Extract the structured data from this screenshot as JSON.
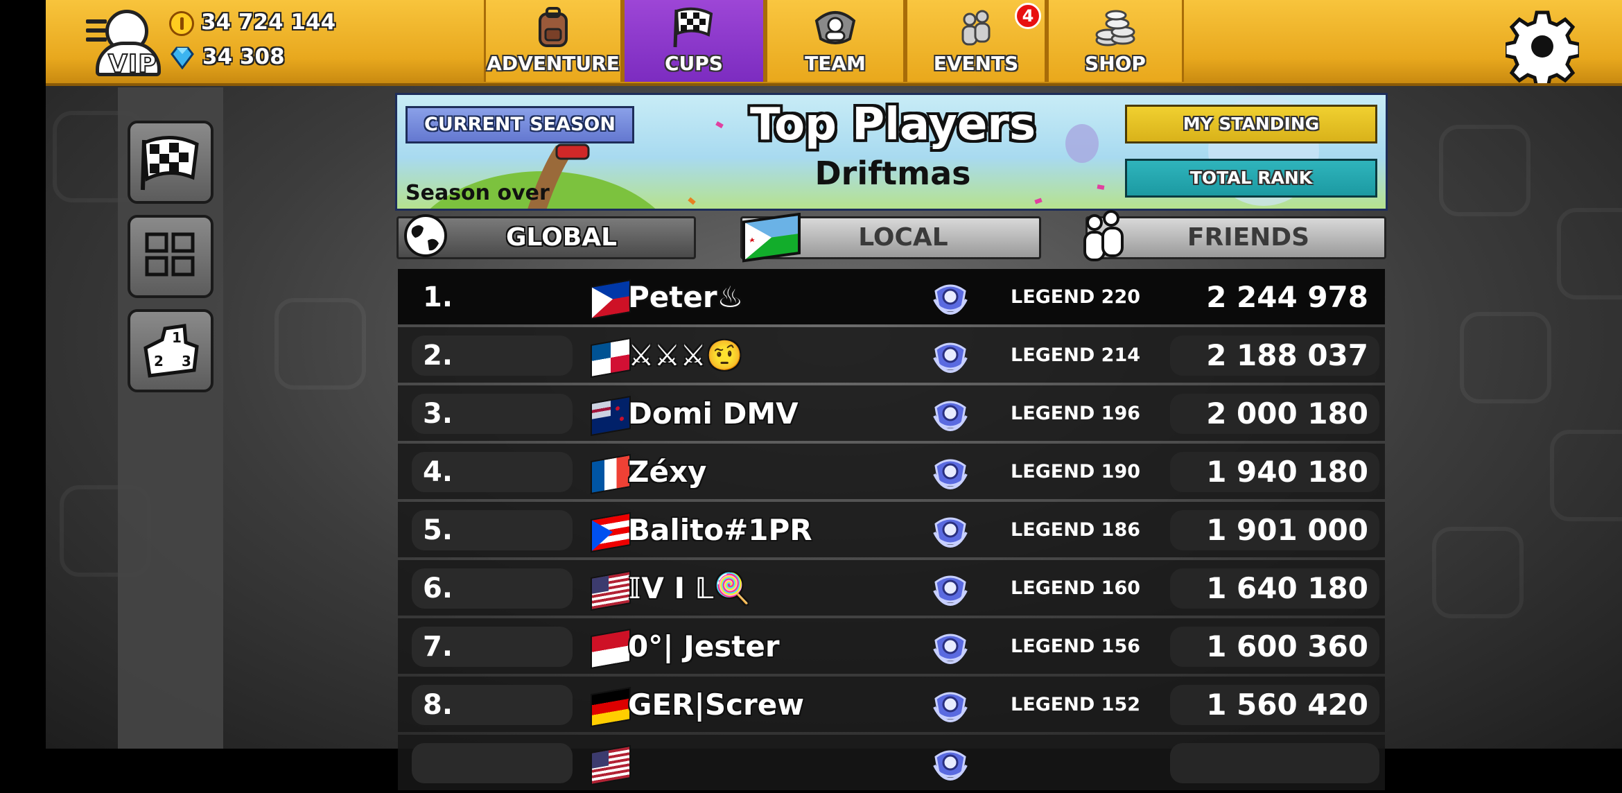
{
  "currency": {
    "coins": "34 724 144",
    "gems": "34 308"
  },
  "profile": {
    "vip_label": "VIP"
  },
  "nav_tabs": [
    {
      "label": "ADVENTURE",
      "icon": "backpack-icon",
      "active": false
    },
    {
      "label": "CUPS",
      "icon": "checkered-flag-icon",
      "active": true
    },
    {
      "label": "TEAM",
      "icon": "team-emblem-icon",
      "active": false
    },
    {
      "label": "EVENTS",
      "icon": "events-people-icon",
      "active": false
    },
    {
      "label": "SHOP",
      "icon": "coin-stack-icon",
      "active": false
    }
  ],
  "events_badge": "4",
  "banner": {
    "current_season": "CURRENT SEASON",
    "season_status": "Season over",
    "title": "Top Players",
    "subtitle": "Driftmas",
    "my_standing": "MY STANDING",
    "total_rank": "TOTAL RANK"
  },
  "scope_tabs": [
    {
      "label": "GLOBAL",
      "icon": "globe-icon",
      "selected": true
    },
    {
      "label": "LOCAL",
      "icon": "djibouti-flag-icon",
      "selected": false
    },
    {
      "label": "FRIENDS",
      "icon": "friends-icon",
      "selected": false
    }
  ],
  "leaderboard": [
    {
      "rank": "1.",
      "name": "Peter♨",
      "flag": "philippines",
      "tier": "LEGEND 220",
      "score": "2 244 978"
    },
    {
      "rank": "2.",
      "name": "⚔⚔⚔🤨",
      "flag": "panama",
      "tier": "LEGEND 214",
      "score": "2 188 037"
    },
    {
      "rank": "3.",
      "name": "Domi DMV",
      "flag": "new-zealand",
      "tier": "LEGEND 196",
      "score": "2 000 180"
    },
    {
      "rank": "4.",
      "name": "Zéxy",
      "flag": "france",
      "tier": "LEGEND 190",
      "score": "1 940 180"
    },
    {
      "rank": "5.",
      "name": "Balito#1PR",
      "flag": "puerto-rico",
      "tier": "LEGEND 186",
      "score": "1 901 000"
    },
    {
      "rank": "6.",
      "name": "𝕀V I 𝕃🍭",
      "flag": "usa",
      "tier": "LEGEND 160",
      "score": "1 640 180"
    },
    {
      "rank": "7.",
      "name": "0°| Jester",
      "flag": "indonesia",
      "tier": "LEGEND 156",
      "score": "1 600 360"
    },
    {
      "rank": "8.",
      "name": "GER|Screw",
      "flag": "germany",
      "tier": "LEGEND 152",
      "score": "1 560 420"
    },
    {
      "rank": "",
      "name": "",
      "flag": "usa",
      "tier": "",
      "score": ""
    }
  ],
  "colors": {
    "topbar": "#f0b428",
    "active_tab": "#8c3ccc",
    "my_standing": "#e6c224",
    "total_rank": "#26a8b0"
  }
}
